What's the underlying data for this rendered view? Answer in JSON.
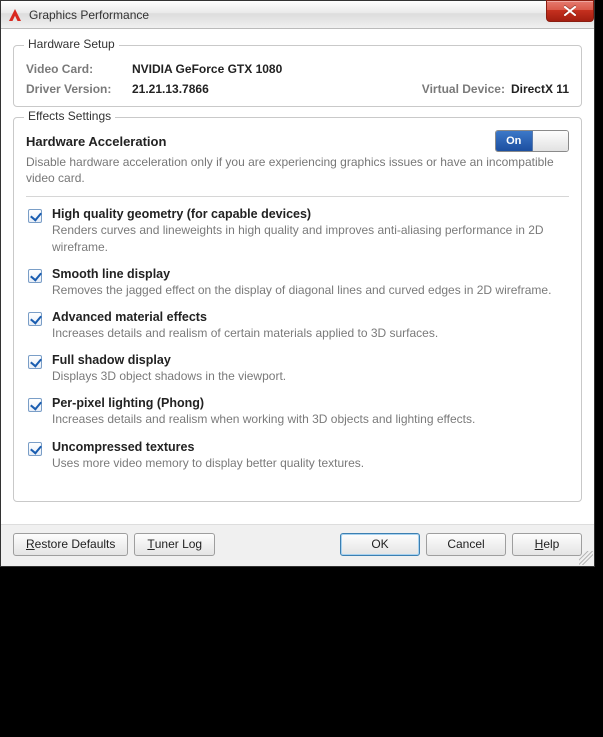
{
  "window": {
    "title": "Graphics Performance"
  },
  "hardware": {
    "groupTitle": "Hardware Setup",
    "videoCardLabel": "Video Card:",
    "videoCard": "NVIDIA GeForce GTX 1080",
    "driverVersionLabel": "Driver Version:",
    "driverVersion": "21.21.13.7866",
    "virtualDeviceLabel": "Virtual Device:",
    "virtualDevice": "DirectX 11"
  },
  "effects": {
    "groupTitle": "Effects Settings",
    "accelTitle": "Hardware Acceleration",
    "accelDesc": "Disable hardware acceleration only if you are experiencing graphics issues or have an incompatible video card.",
    "toggle": {
      "state": "On",
      "onLabel": "On",
      "offLabel": ""
    },
    "options": [
      {
        "checked": true,
        "title": "High quality geometry (for capable devices)",
        "desc": "Renders curves and lineweights in high quality and improves anti-aliasing performance in 2D wireframe."
      },
      {
        "checked": true,
        "title": "Smooth line display",
        "desc": "Removes the jagged effect on the display of diagonal lines and curved edges in 2D wireframe."
      },
      {
        "checked": true,
        "title": "Advanced material effects",
        "desc": "Increases details and realism of certain materials applied to 3D surfaces."
      },
      {
        "checked": true,
        "title": "Full shadow display",
        "desc": "Displays 3D object shadows in the viewport."
      },
      {
        "checked": true,
        "title": "Per-pixel lighting (Phong)",
        "desc": "Increases details and realism when working with 3D objects and lighting effects."
      },
      {
        "checked": true,
        "title": "Uncompressed textures",
        "desc": "Uses more video memory to display better quality textures."
      }
    ]
  },
  "buttons": {
    "restoreDefaults": {
      "pre": "",
      "u": "R",
      "post": "estore Defaults"
    },
    "tunerLog": {
      "pre": "",
      "u": "T",
      "post": "uner Log"
    },
    "ok": "OK",
    "cancel": "Cancel",
    "help": {
      "pre": "",
      "u": "H",
      "post": "elp"
    }
  }
}
